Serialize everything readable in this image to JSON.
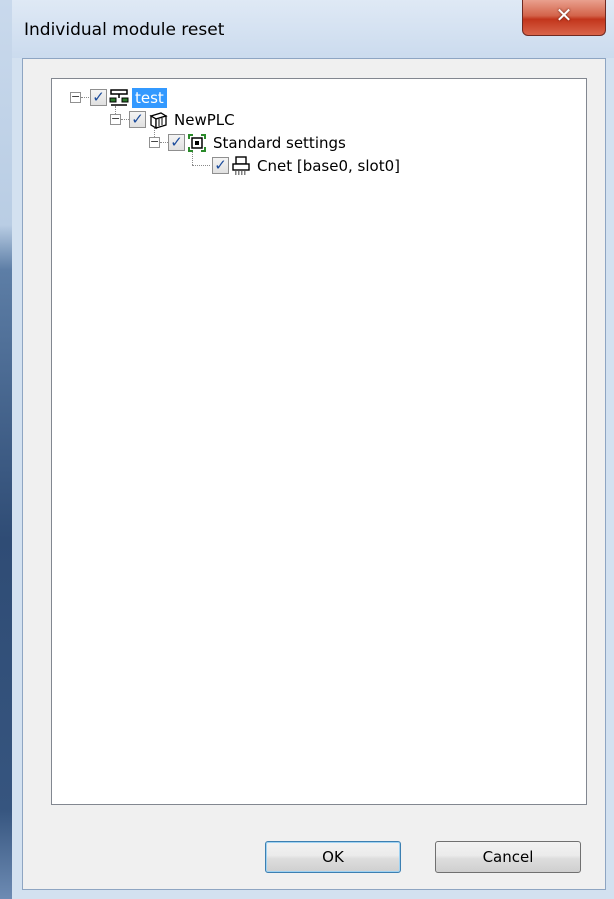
{
  "dialog": {
    "title": "Individual module reset",
    "close_label": "✕"
  },
  "tree": {
    "nodes": [
      {
        "label": "test",
        "checked": true,
        "expanded": true,
        "selected": true,
        "icon": "project-network-icon"
      },
      {
        "label": "NewPLC",
        "checked": true,
        "expanded": true,
        "selected": false,
        "icon": "plc-icon"
      },
      {
        "label": "Standard settings",
        "checked": true,
        "expanded": true,
        "selected": false,
        "icon": "settings-module-icon"
      },
      {
        "label": "Cnet [base0, slot0]",
        "checked": true,
        "expanded": false,
        "selected": false,
        "icon": "cnet-module-icon"
      }
    ]
  },
  "buttons": {
    "ok_label": "OK",
    "cancel_label": "Cancel"
  },
  "glyphs": {
    "check": "✓",
    "minus": "−"
  }
}
